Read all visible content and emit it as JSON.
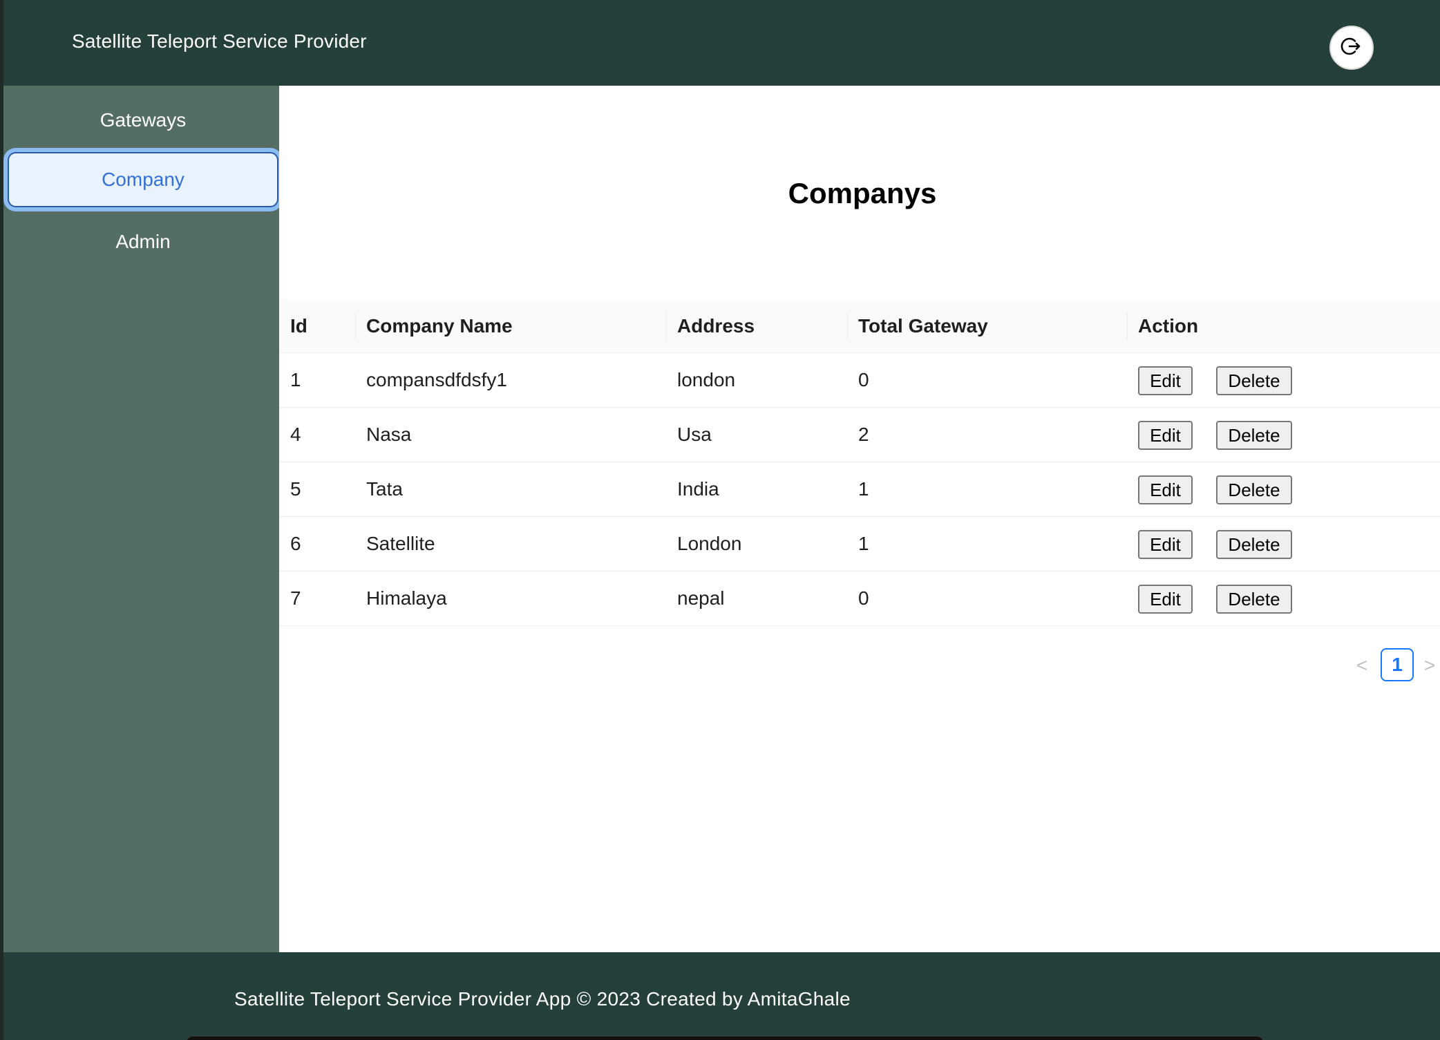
{
  "header": {
    "title": "Satellite Teleport Service Provider",
    "logout_icon": "logout-icon"
  },
  "sidebar": {
    "items": [
      {
        "label": "Gateways",
        "active": false
      },
      {
        "label": "Company",
        "active": true
      },
      {
        "label": "Admin",
        "active": false
      }
    ]
  },
  "main": {
    "title": "Companys"
  },
  "table": {
    "columns": [
      "Id",
      "Company Name",
      "Address",
      "Total Gateway",
      "Action"
    ],
    "rows": [
      {
        "id": "1",
        "name": "compansdfdsfy1",
        "address": "london",
        "total": "0"
      },
      {
        "id": "4",
        "name": "Nasa",
        "address": "Usa",
        "total": "2"
      },
      {
        "id": "5",
        "name": "Tata",
        "address": "India",
        "total": "1"
      },
      {
        "id": "6",
        "name": "Satellite",
        "address": "London",
        "total": "1"
      },
      {
        "id": "7",
        "name": "Himalaya",
        "address": "nepal",
        "total": "0"
      }
    ],
    "edit_label": "Edit",
    "delete_label": "Delete"
  },
  "pagination": {
    "prev": "<",
    "current": "1",
    "next": ">"
  },
  "footer": {
    "text": "Satellite Teleport Service Provider App © 2023 Created by AmitaGhale"
  },
  "colors": {
    "header_bg": "#253f3a",
    "sidebar_bg": "#546e66",
    "active_item_bg": "#e8f3ff",
    "active_item_text": "#3470d6",
    "pagination_accent": "#1677ff"
  }
}
